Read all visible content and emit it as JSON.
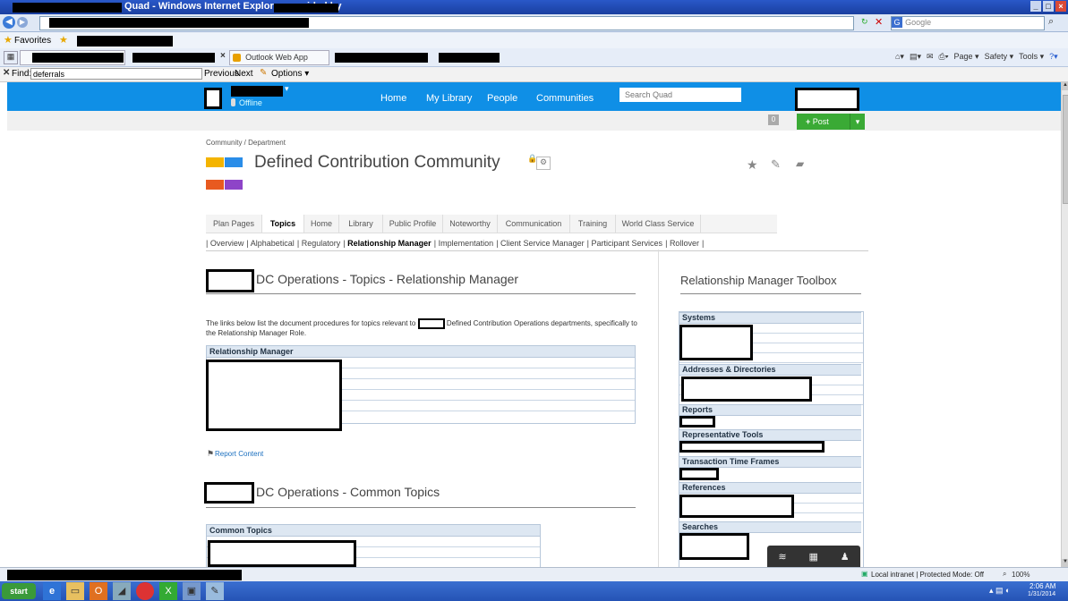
{
  "window": {
    "title": "Quad - Windows Internet Explorer provided by",
    "window_controls": [
      "_",
      "□",
      "×"
    ]
  },
  "address": {
    "search_placeholder": "Google"
  },
  "favorites": {
    "label": "Favorites"
  },
  "tabs_bar": {
    "outlook_tab": "Outlook Web App",
    "toolbar": [
      "Page ▾",
      "Safety ▾",
      "Tools ▾"
    ]
  },
  "find": {
    "label": "Find:",
    "value": "deferrals",
    "previous": "Previous",
    "next": "Next",
    "options": "Options ▾"
  },
  "quad_nav": {
    "status": "Offline",
    "links": [
      "Home",
      "My Library",
      "People",
      "Communities"
    ],
    "search_placeholder": "Search Quad"
  },
  "subnav": {
    "post_button": "Post"
  },
  "page": {
    "breadcrumb": "Community / Department",
    "title": "Defined Contribution Community",
    "tabs": [
      "Plan Pages",
      "Topics",
      "Home",
      "Library",
      "Public Profile",
      "Noteworthy",
      "Communication",
      "Training",
      "World Class Service"
    ],
    "active_tab": "Topics",
    "subtabs": [
      "Overview",
      "Alphabetical",
      "Regulatory",
      "Relationship Manager",
      "Implementation",
      "Client Service Manager",
      "Participant Services",
      "Rollover"
    ],
    "active_subtab": "Relationship Manager"
  },
  "main": {
    "section1_title": "DC Operations - Topics - Relationship Manager",
    "intro_part1": "The links below list the document procedures for topics relevant to",
    "intro_part2": "Defined Contribution Operations departments, specifically to the Relationship Manager Role.",
    "table1_header": "Relationship Manager",
    "report_link": "Report Content",
    "section2_title": "DC Operations - Common Topics",
    "table2_header": "Common Topics"
  },
  "toolbox": {
    "title": "Relationship Manager Toolbox",
    "sections": [
      "Systems",
      "Addresses & Directories",
      "Reports",
      "Representative Tools",
      "Transaction Time Frames",
      "References",
      "Searches"
    ]
  },
  "status": {
    "zone": "Local intranet | Protected Mode: Off",
    "zoom": "100%"
  },
  "taskbar": {
    "start": "start",
    "time": "2:06 AM",
    "date": "1/31/2014"
  }
}
